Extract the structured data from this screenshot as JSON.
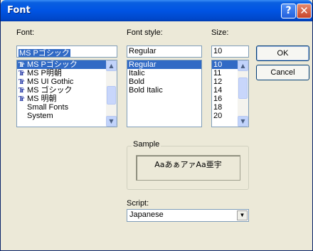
{
  "window": {
    "title": "Font",
    "help_glyph": "?",
    "close_glyph": "✕"
  },
  "font": {
    "label": "Font:",
    "value": "MS Pゴシック",
    "items": [
      {
        "name": "MS Pゴシック",
        "icon": "truetype-icon",
        "selected": true
      },
      {
        "name": "MS P明朝",
        "icon": "truetype-icon",
        "selected": false
      },
      {
        "name": "MS UI Gothic",
        "icon": "truetype-icon",
        "selected": false
      },
      {
        "name": "MS ゴシック",
        "icon": "truetype-icon",
        "selected": false
      },
      {
        "name": "MS 明朝",
        "icon": "truetype-icon",
        "selected": false
      },
      {
        "name": "Small Fonts",
        "icon": "",
        "selected": false
      },
      {
        "name": "System",
        "icon": "",
        "selected": false
      }
    ]
  },
  "style": {
    "label": "Font style:",
    "value": "Regular",
    "items": [
      {
        "name": "Regular",
        "selected": true
      },
      {
        "name": "Italic",
        "selected": false
      },
      {
        "name": "Bold",
        "selected": false
      },
      {
        "name": "Bold Italic",
        "selected": false
      }
    ]
  },
  "size": {
    "label": "Size:",
    "value": "10",
    "items": [
      {
        "name": "10",
        "selected": true
      },
      {
        "name": "11",
        "selected": false
      },
      {
        "name": "12",
        "selected": false
      },
      {
        "name": "14",
        "selected": false
      },
      {
        "name": "16",
        "selected": false
      },
      {
        "name": "18",
        "selected": false
      },
      {
        "name": "20",
        "selected": false
      }
    ]
  },
  "buttons": {
    "ok": "OK",
    "cancel": "Cancel"
  },
  "sample": {
    "label": "Sample",
    "text": "AaあぁアァAa亜宇"
  },
  "script": {
    "label": "Script:",
    "value": "Japanese"
  },
  "icons": {
    "truetype_glyph": "Tr",
    "up": "▲",
    "down": "▼"
  },
  "colors": {
    "titlebar": "#0054e3",
    "selection": "#316ac5",
    "face": "#ece9d8"
  }
}
